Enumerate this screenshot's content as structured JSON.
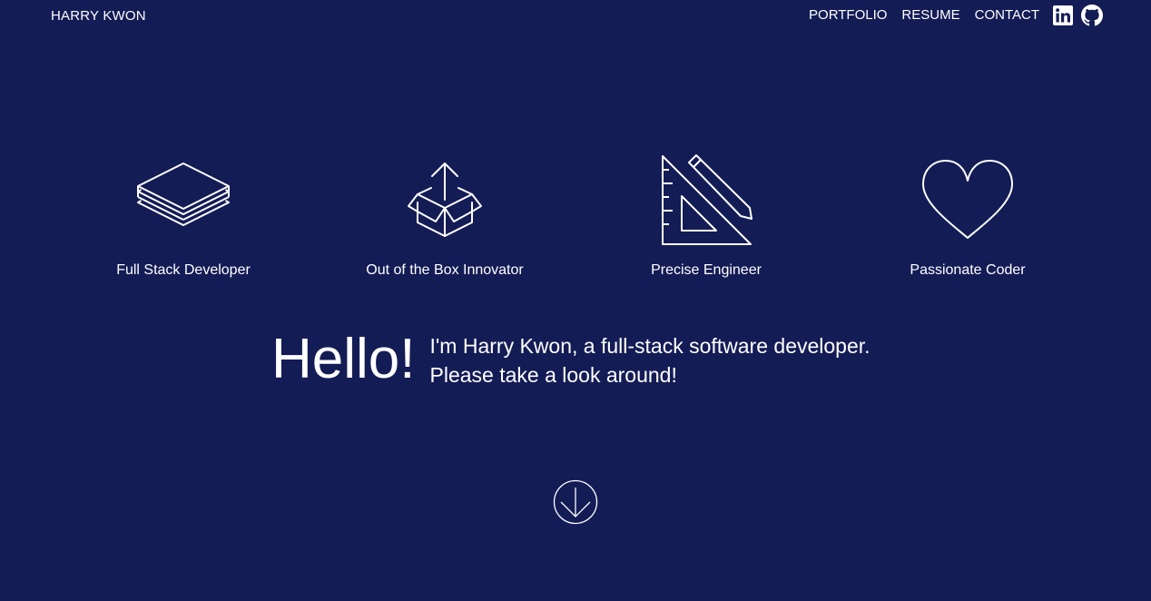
{
  "header": {
    "brand": "HARRY KWON",
    "nav": [
      {
        "label": "PORTFOLIO"
      },
      {
        "label": "RESUME"
      },
      {
        "label": "CONTACT"
      }
    ],
    "social": [
      {
        "icon": "linkedin-icon"
      },
      {
        "icon": "github-icon"
      }
    ]
  },
  "features": [
    {
      "label": "Full Stack Developer",
      "icon": "layers-stack-icon"
    },
    {
      "label": "Out of the Box Innovator",
      "icon": "open-box-icon"
    },
    {
      "label": "Precise Engineer",
      "icon": "triangle-ruler-pencil-icon"
    },
    {
      "label": "Passionate Coder",
      "icon": "heart-icon"
    }
  ],
  "intro": {
    "greeting": "Hello!",
    "line1": "I'm Harry Kwon, a full-stack software developer.",
    "line2": "Please take a look around!"
  },
  "scroll_down": {
    "icon": "arrow-down-circle-icon"
  },
  "colors": {
    "background": "#141c56",
    "foreground": "#ffffff"
  }
}
